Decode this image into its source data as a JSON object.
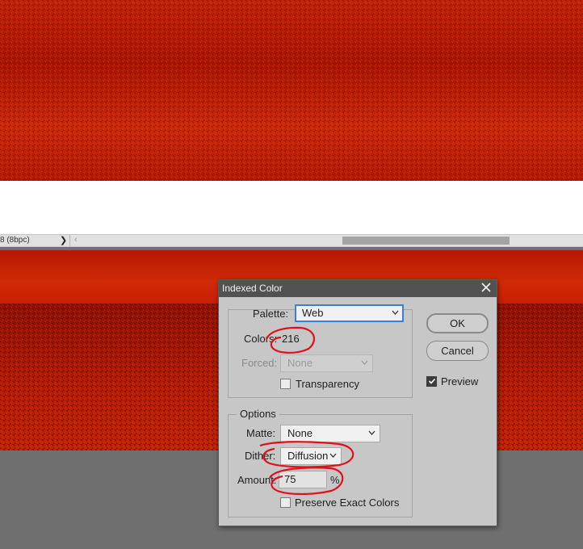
{
  "status_bar": {
    "doc_info": "8 (8bpc)",
    "nav_arrow": "❯",
    "scroll_left_arrow": "‹"
  },
  "dialog": {
    "title": "Indexed Color",
    "palette": {
      "label": "Palette:",
      "value": "Web"
    },
    "colors": {
      "label": "Colors:",
      "value": "216"
    },
    "forced": {
      "label": "Forced:",
      "value": "None"
    },
    "transparency": {
      "label": "Transparency",
      "checked": false
    },
    "options_legend": "Options",
    "matte": {
      "label": "Matte:",
      "value": "None"
    },
    "dither": {
      "label": "Dither:",
      "value": "Diffusion"
    },
    "amount": {
      "label": "Amount:",
      "value": "75",
      "unit": "%"
    },
    "preserve_exact_colors": {
      "label": "Preserve Exact Colors",
      "checked": false
    },
    "buttons": {
      "ok": "OK",
      "cancel": "Cancel"
    },
    "preview": {
      "label": "Preview",
      "checked": true
    }
  },
  "colors": {
    "titlebar": "#525252",
    "dialog_bg": "#c7c7c7",
    "focus_blue": "#3b7fd4",
    "annotation_red": "#e0101a",
    "image_red": "#b81a04",
    "canvas_gray": "#6f6f6f"
  },
  "icons": {
    "close": "close-icon",
    "chevron": "chevron-down-icon",
    "check": "checkmark-icon"
  }
}
